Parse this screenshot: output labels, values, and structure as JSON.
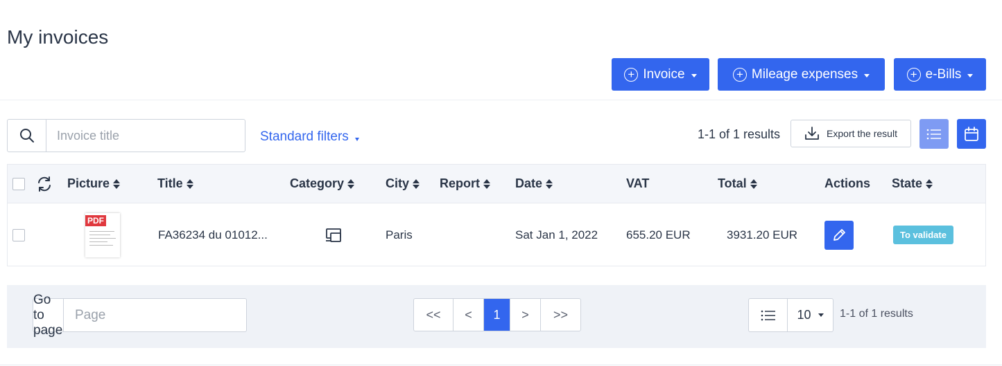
{
  "page": {
    "title": "My invoices"
  },
  "actions": {
    "invoice_label": "Invoice",
    "mileage_label": "Mileage expenses",
    "ebills_label": "e-Bills",
    "accent_color": "#3366ee"
  },
  "toolbar": {
    "search_placeholder": "Invoice title",
    "standard_filters": "Standard filters",
    "results_count": "1-1 of 1 results",
    "export_label": "Export the result"
  },
  "table": {
    "columns": {
      "picture": "Picture",
      "title": "Title",
      "category": "Category",
      "city": "City",
      "report": "Report",
      "date": "Date",
      "vat": "VAT",
      "total": "Total",
      "actions": "Actions",
      "state": "State"
    },
    "rows": [
      {
        "picture_icon": "pdf-thumbnail",
        "title": "FA36234 du 01012...",
        "category_icon": "devices-icon",
        "city": "Paris",
        "report": "",
        "date": "Sat Jan 1, 2022",
        "vat": "655.20 EUR",
        "total": "3931.20 EUR",
        "state": "To validate",
        "state_color": "#5bc0de"
      }
    ]
  },
  "pagination": {
    "goto_label": "Go to page",
    "goto_placeholder": "Page",
    "first": "<<",
    "prev": "<",
    "current": "1",
    "next": ">",
    "last": ">>",
    "per_page": "10",
    "results": "1-1 of 1 results"
  }
}
